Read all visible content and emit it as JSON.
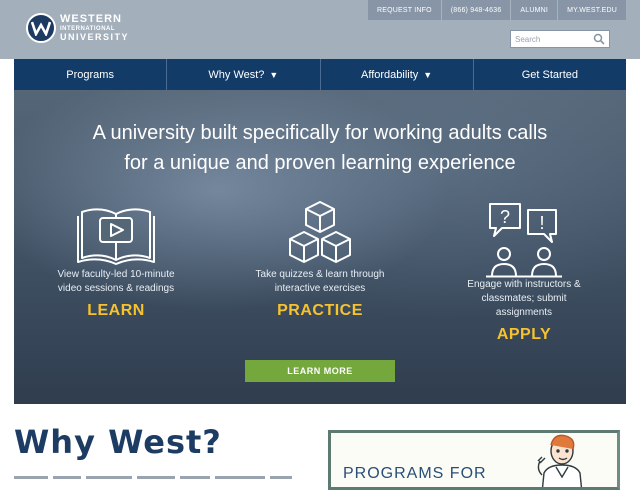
{
  "brand": {
    "line1": "WESTERN",
    "line2": "INTERNATIONAL",
    "line3": "UNIVERSITY",
    "colors": {
      "header": "#a3afbb",
      "navy": "#123b68",
      "gold": "#f6c22d",
      "green": "#74a83c"
    }
  },
  "utility_nav": [
    "REQUEST INFO",
    "(866) 948-4636",
    "ALUMNI",
    "MY.WEST.EDU"
  ],
  "search": {
    "placeholder": "Search",
    "value": ""
  },
  "main_nav": [
    {
      "label": "Programs",
      "caret": ""
    },
    {
      "label": "Why West?",
      "caret": "▼"
    },
    {
      "label": "Affordability",
      "caret": "▼"
    },
    {
      "label": "Get Started",
      "caret": ""
    }
  ],
  "hero": {
    "headline_line1": "A university built specifically for working adults calls",
    "headline_line2": "for a unique and proven learning experience",
    "features": [
      {
        "icon": "book-video-icon",
        "desc_line1": "View faculty-led 10-minute",
        "desc_line2": "video sessions & readings",
        "desc_line3": "",
        "heading": "LEARN"
      },
      {
        "icon": "cubes-icon",
        "desc_line1": "Take quizzes & learn through",
        "desc_line2": "interactive exercises",
        "desc_line3": "",
        "heading": "PRACTICE"
      },
      {
        "icon": "discussion-icon",
        "desc_line1": "Engage with instructors &",
        "desc_line2": "classmates; submit",
        "desc_line3": "assignments",
        "heading": "APPLY"
      }
    ],
    "cta": "LEARN MORE"
  },
  "why_west": {
    "title": "Why West?"
  },
  "promo": {
    "text": "PROGRAMS FOR"
  }
}
